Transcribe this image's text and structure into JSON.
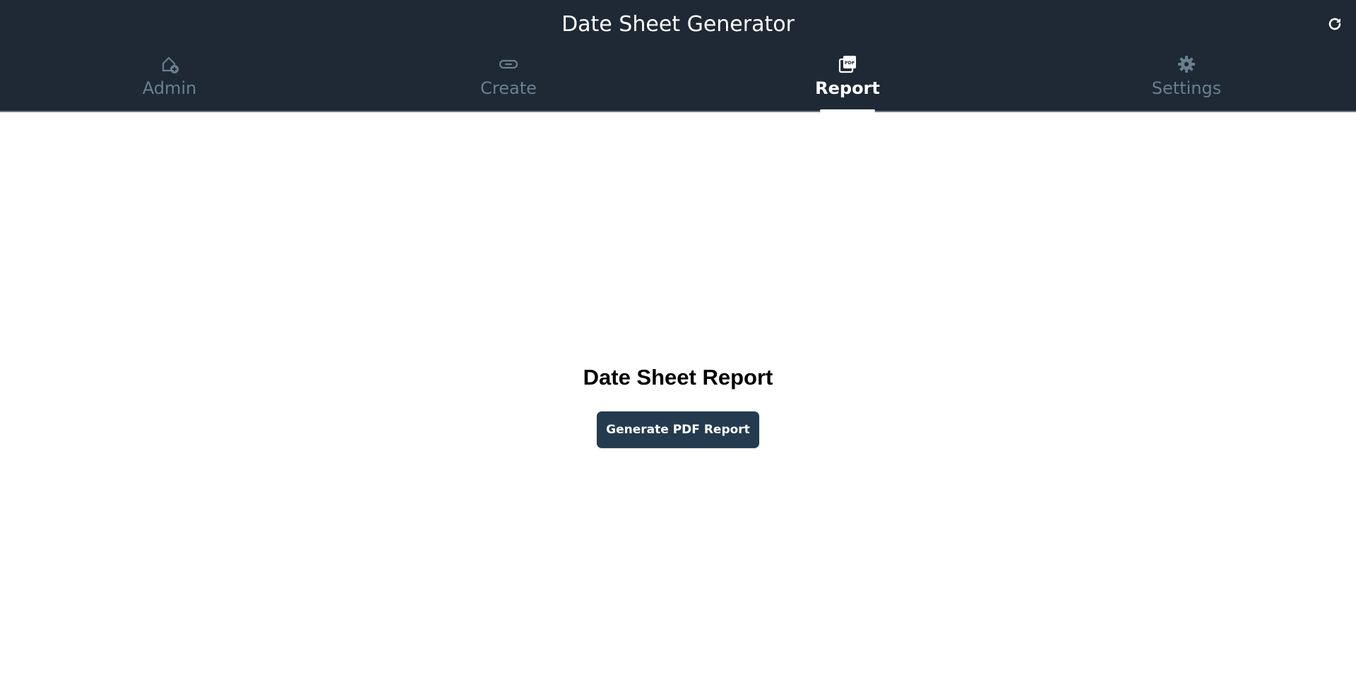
{
  "app": {
    "title": "Date Sheet Generator"
  },
  "header": {
    "refresh_icon": "refresh-icon"
  },
  "tabs": [
    {
      "label": "Admin",
      "icon": "home-add-icon",
      "active": false
    },
    {
      "label": "Create",
      "icon": "link-icon",
      "active": false
    },
    {
      "label": "Report",
      "icon": "pdf-file-icon",
      "active": true
    },
    {
      "label": "Settings",
      "icon": "gear-icon",
      "active": false
    }
  ],
  "main": {
    "title": "Date Sheet Report",
    "generate_button_label": "Generate PDF Report"
  },
  "colors": {
    "header_bg": "#1e2935",
    "inactive_tab": "#6b7f8f",
    "active_tab": "#ffffff",
    "button_bg": "#243a4f"
  }
}
